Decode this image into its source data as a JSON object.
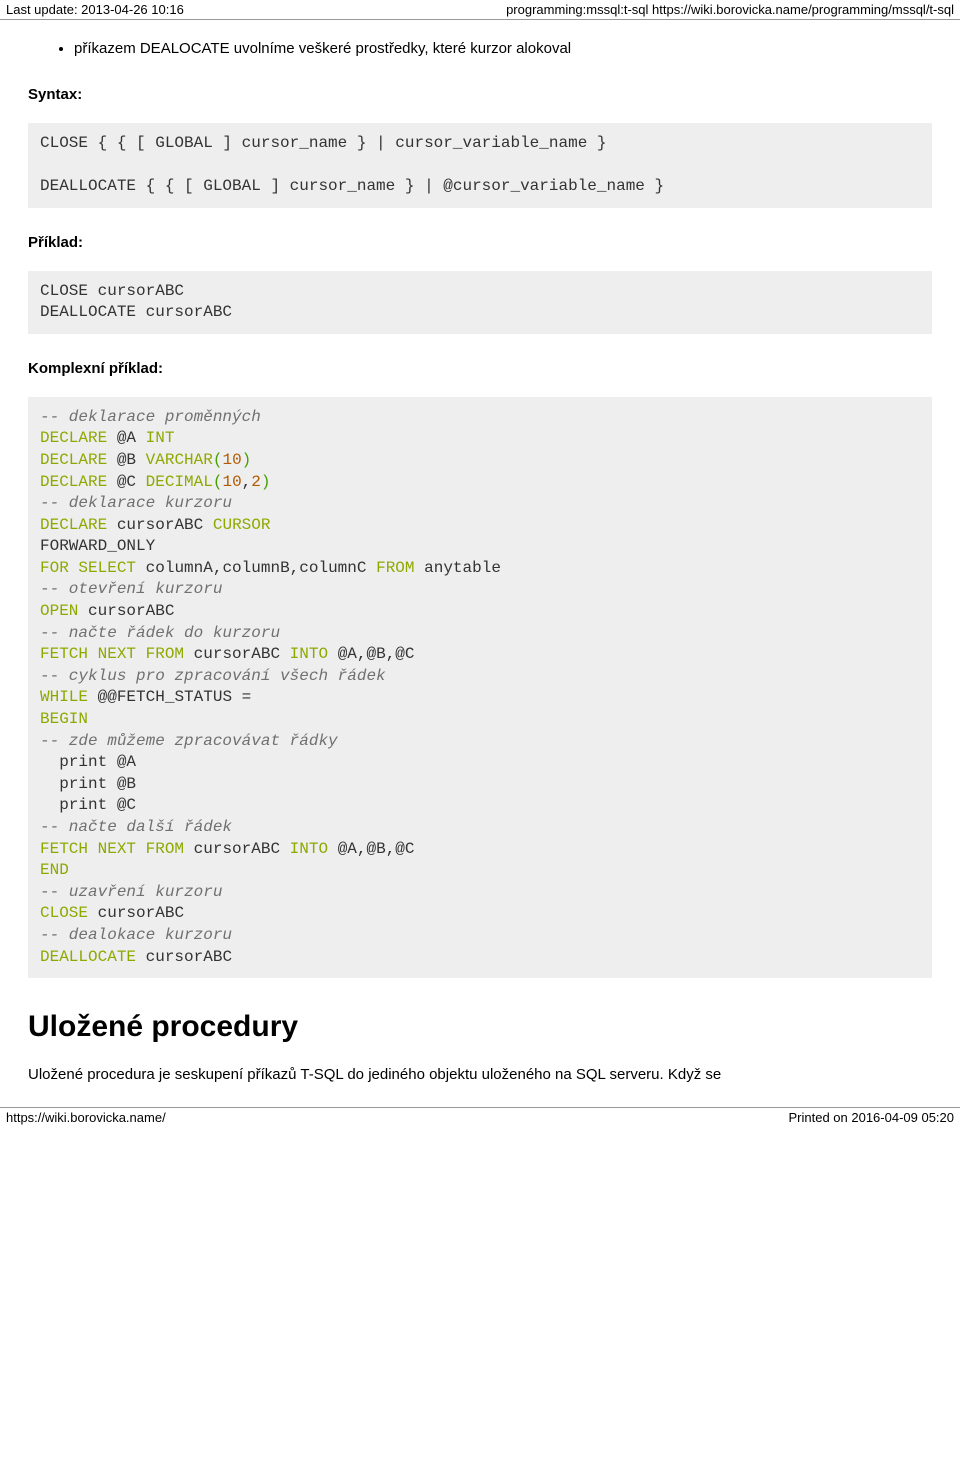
{
  "header": {
    "left": "Last update: 2013-04-26 10:16",
    "right": "programming:mssql:t-sql https://wiki.borovicka.name/programming/mssql/t-sql"
  },
  "bullet": "příkazem DEALOCATE uvolníme veškeré prostředky, které kurzor alokoval",
  "labels": {
    "syntax": "Syntax:",
    "example": "Příklad:",
    "complex_example": "Komplexní příklad:"
  },
  "code1_text": "CLOSE { { [ GLOBAL ] cursor_name } | cursor_variable_name }\n\nDEALLOCATE { { [ GLOBAL ] cursor_name } | @cursor_variable_name }",
  "code2_text": "CLOSE cursorABC\nDEALLOCATE cursorABC",
  "code3": {
    "c1": "-- deklarace proměnných",
    "l1a": "DECLARE",
    "l1b": "@A",
    "l1c": "INT",
    "l2a": "DECLARE",
    "l2b": "@B",
    "l2c": "VARCHAR",
    "l2d": "10",
    "l3a": "DECLARE",
    "l3b": "@C",
    "l3c": "DECIMAL",
    "l3d": "10",
    "l3e": "2",
    "c2": "-- deklarace kurzoru",
    "l4a": "DECLARE",
    "l4b": "cursorABC",
    "l4c": "CURSOR",
    "l5": "FORWARD_ONLY",
    "l6a": "FOR",
    "l6b": "SELECT",
    "l6c": "columnA,columnB,columnC",
    "l6d": "FROM",
    "l6e": "anytable",
    "c3": "-- otevření kurzoru",
    "l7a": "OPEN",
    "l7b": "cursorABC",
    "c4": "-- načte řádek do kurzoru",
    "l8a": "FETCH NEXT FROM",
    "l8b": "cursorABC",
    "l8c": "INTO",
    "l8d": "@A,@B,@C",
    "c5": "-- cyklus pro zpracování všech řádek",
    "l9a": "WHILE",
    "l9b": "@@FETCH_STATUS =",
    "l10": "BEGIN",
    "c6": "-- zde můžeme zpracovávat řádky",
    "l11": "  print @A",
    "l12": "  print @B",
    "l13": "  print @C",
    "c7": "-- načte další řádek",
    "l14a": "FETCH NEXT FROM",
    "l14b": "cursorABC",
    "l14c": "INTO",
    "l14d": "@A,@B,@C",
    "l15": "END",
    "c8": "-- uzavření kurzoru",
    "l16a": "CLOSE",
    "l16b": "cursorABC",
    "c9": "-- dealokace kurzoru",
    "l17a": "DEALLOCATE",
    "l17b": "cursorABC"
  },
  "section_heading": "Uložené procedury",
  "paragraph": "Uložené procedura je seskupení příkazů T-SQL do jediného objektu uloženého na SQL serveru. Když se",
  "footer": {
    "left": "https://wiki.borovicka.name/",
    "right": "Printed on 2016-04-09 05:20"
  }
}
